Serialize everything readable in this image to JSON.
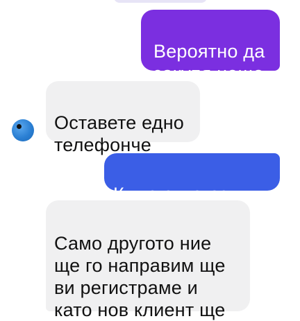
{
  "messages": [
    {
      "id": "m1",
      "sender": "me",
      "text": "Вероятно да\nзакупя нещо"
    },
    {
      "id": "m2",
      "sender": "contact",
      "text": "Оставете едно\nтелефонче"
    },
    {
      "id": "m3",
      "sender": "me",
      "text": "Къде е магазиът"
    },
    {
      "id": "m4",
      "sender": "contact",
      "text": "Само другото ние\nще го направим ще\nви регистраме и\nкато нов клиент ще"
    }
  ],
  "colors": {
    "outgoing_primary": "#7b2fe0",
    "outgoing_secondary": "#3b5ee6",
    "incoming_bg": "#f0f0f1",
    "avatar": "#2a7fd3"
  },
  "avatar": {
    "icon": "contact-avatar-icon"
  }
}
